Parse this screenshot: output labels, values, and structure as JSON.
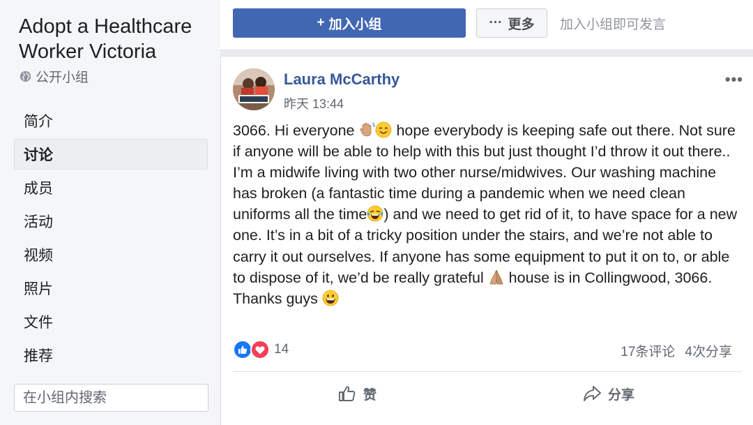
{
  "sidebar": {
    "group_title_line1": "Adopt a Healthcare",
    "group_title_line2": "Worker Victoria",
    "privacy": "公开小组",
    "privacy_icon": "globe-icon",
    "nav": [
      {
        "label": "简介",
        "active": false
      },
      {
        "label": "讨论",
        "active": true
      },
      {
        "label": "成员",
        "active": false
      },
      {
        "label": "活动",
        "active": false
      },
      {
        "label": "视频",
        "active": false
      },
      {
        "label": "照片",
        "active": false
      },
      {
        "label": "文件",
        "active": false
      },
      {
        "label": "推荐",
        "active": false
      }
    ],
    "search": {
      "placeholder": "在小组内搜索",
      "value": "",
      "icon": "search-icon"
    }
  },
  "topbar": {
    "join_icon": "+",
    "join_label": "加入小组",
    "more_icon": "···",
    "more_label": "更多",
    "hint": "加入小组即可发言"
  },
  "post": {
    "author": "Laura McCarthy",
    "timestamp": "昨天 13:44",
    "menu_icon": "•••",
    "body": {
      "p1": "3066. Hi everyone ",
      "p2": " hope everybody is keeping safe out there. Not sure if anyone will be able to help with this but just thought I’d throw it out there.. I’m a midwife living with two other nurse/midwives. Our washing machine has broken (a fantastic time during a pandemic when we need clean uniforms all the time",
      "p3": ") and we need to get rid of it, to have space for a new one. It’s in a bit of a tricky position under the stairs, and we’re not able to carry it out ourselves. If anyone has some equipment to put it on to, or able to dispose of it, we’d be really grateful ",
      "p4": " house is in Collingwood, 3066. Thanks guys "
    },
    "reactions": {
      "count": "14",
      "types": [
        "like",
        "love"
      ]
    },
    "comments": "17条评论",
    "shares": "4次分享",
    "actions": {
      "like": "赞",
      "share": "分享"
    },
    "colors": {
      "accent": "#4267b2",
      "author": "#365899",
      "like": "#1877f2",
      "love": "#f33e58"
    }
  }
}
